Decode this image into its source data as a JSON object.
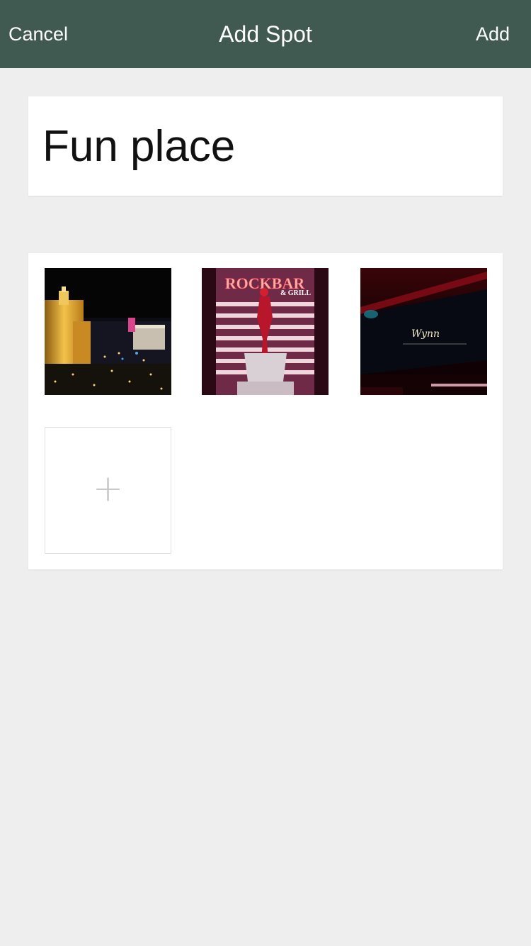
{
  "navbar": {
    "cancel_label": "Cancel",
    "title": "Add Spot",
    "add_label": "Add",
    "background": "#405951"
  },
  "spot": {
    "name_value": "Fun place"
  },
  "photos": [
    {
      "name": "las-vegas-skyline-photo"
    },
    {
      "name": "rockbar-grill-sign-photo",
      "sign_text": "ROCKBAR",
      "sign_subtext": "& GRILL"
    },
    {
      "name": "wynn-interior-photo",
      "sign_text": "Wynn"
    }
  ],
  "add_photo": {
    "icon": "plus-icon",
    "glyph": "+"
  }
}
